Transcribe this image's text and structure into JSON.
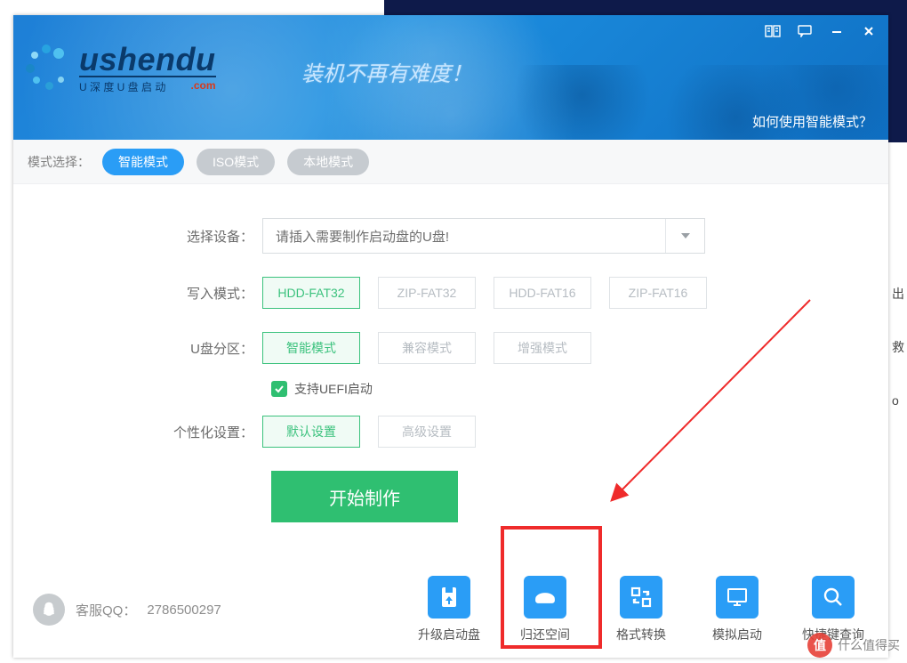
{
  "window": {
    "brand_main": "ushendu",
    "brand_sub_cn": "U 深 度 U 盘 启 动",
    "brand_sub_dom": ".com",
    "slogan": "装机不再有难度！",
    "help_link": "如何使用智能模式？"
  },
  "modes": {
    "label": "模式选择：",
    "items": [
      "智能模式",
      "ISO模式",
      "本地模式"
    ],
    "active": 0
  },
  "form": {
    "device_label": "选择设备：",
    "device_placeholder": "请插入需要制作启动盘的U盘!",
    "write_label": "写入模式：",
    "write_opts": [
      "HDD-FAT32",
      "ZIP-FAT32",
      "HDD-FAT16",
      "ZIP-FAT16"
    ],
    "write_sel": 0,
    "part_label": "U盘分区：",
    "part_opts": [
      "智能模式",
      "兼容模式",
      "增强模式"
    ],
    "part_sel": 0,
    "uefi_label": "支持UEFI启动",
    "uefi_checked": true,
    "custom_label": "个性化设置：",
    "custom_opts": [
      "默认设置",
      "高级设置"
    ],
    "custom_sel": 0,
    "start_btn": "开始制作"
  },
  "footer": {
    "qq_label": "客服QQ：",
    "qq_number": "2786500297",
    "tools": [
      "升级启动盘",
      "归还空间",
      "格式转换",
      "模拟启动",
      "快捷键查询"
    ]
  },
  "watermark": {
    "badge": "值",
    "text": "什么值得买"
  },
  "bg": {
    "t1": "出",
    "t2": "救",
    "t3": "o"
  }
}
